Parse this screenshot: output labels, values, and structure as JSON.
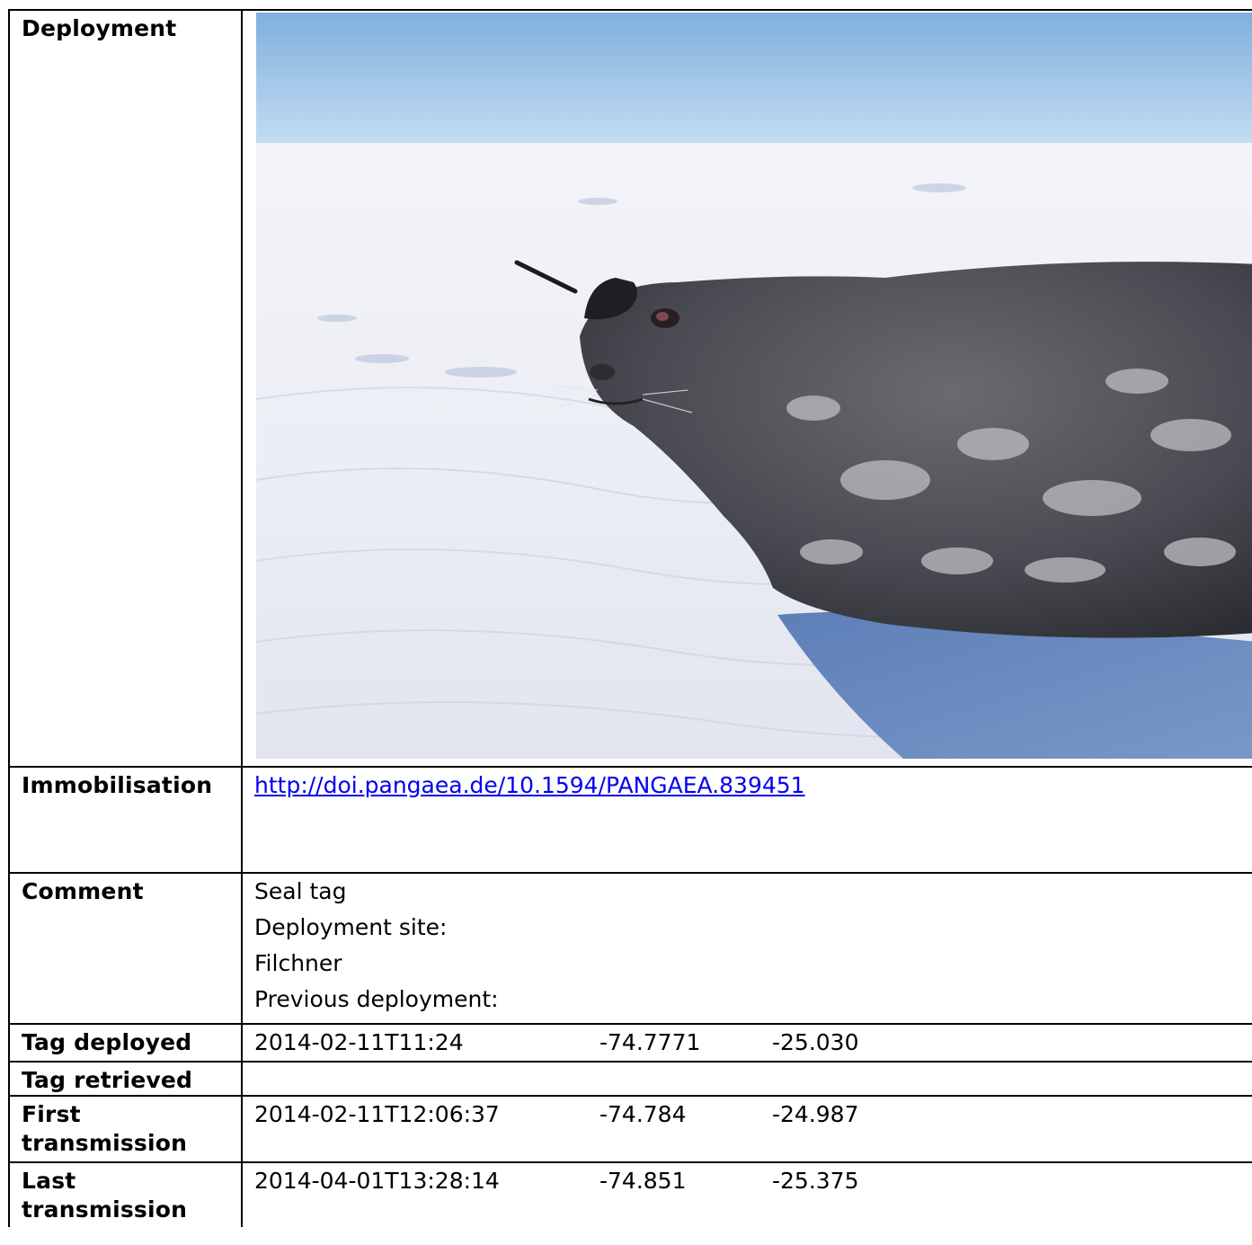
{
  "rows": {
    "deployment": {
      "label": "Deployment"
    },
    "immobilisation": {
      "label": "Immobilisation",
      "link": "http://doi.pangaea.de/10.1594/PANGAEA.839451"
    },
    "comment": {
      "label": "Comment",
      "lines": [
        "Seal tag",
        "Deployment site:",
        "Filchner",
        "Previous deployment:"
      ]
    },
    "tag_deployed": {
      "label": "Tag deployed",
      "time": "2014-02-11T11:24",
      "lat": "-74.7771",
      "lon": "-25.030"
    },
    "tag_retrieved": {
      "label": "Tag retrieved"
    },
    "first_transmission": {
      "label": "First transmission",
      "time": "2014-02-11T12:06:37",
      "lat": "-74.784",
      "lon": "-24.987"
    },
    "last_transmission": {
      "label": "Last transmission",
      "time": "2014-04-01T13:28:14",
      "lat": "-74.851",
      "lon": "-25.375"
    }
  },
  "colors": {
    "link": "#0000ee",
    "sky": "#9ec4e6",
    "snow": "#eef0f6",
    "seal": "#4a4a52"
  }
}
